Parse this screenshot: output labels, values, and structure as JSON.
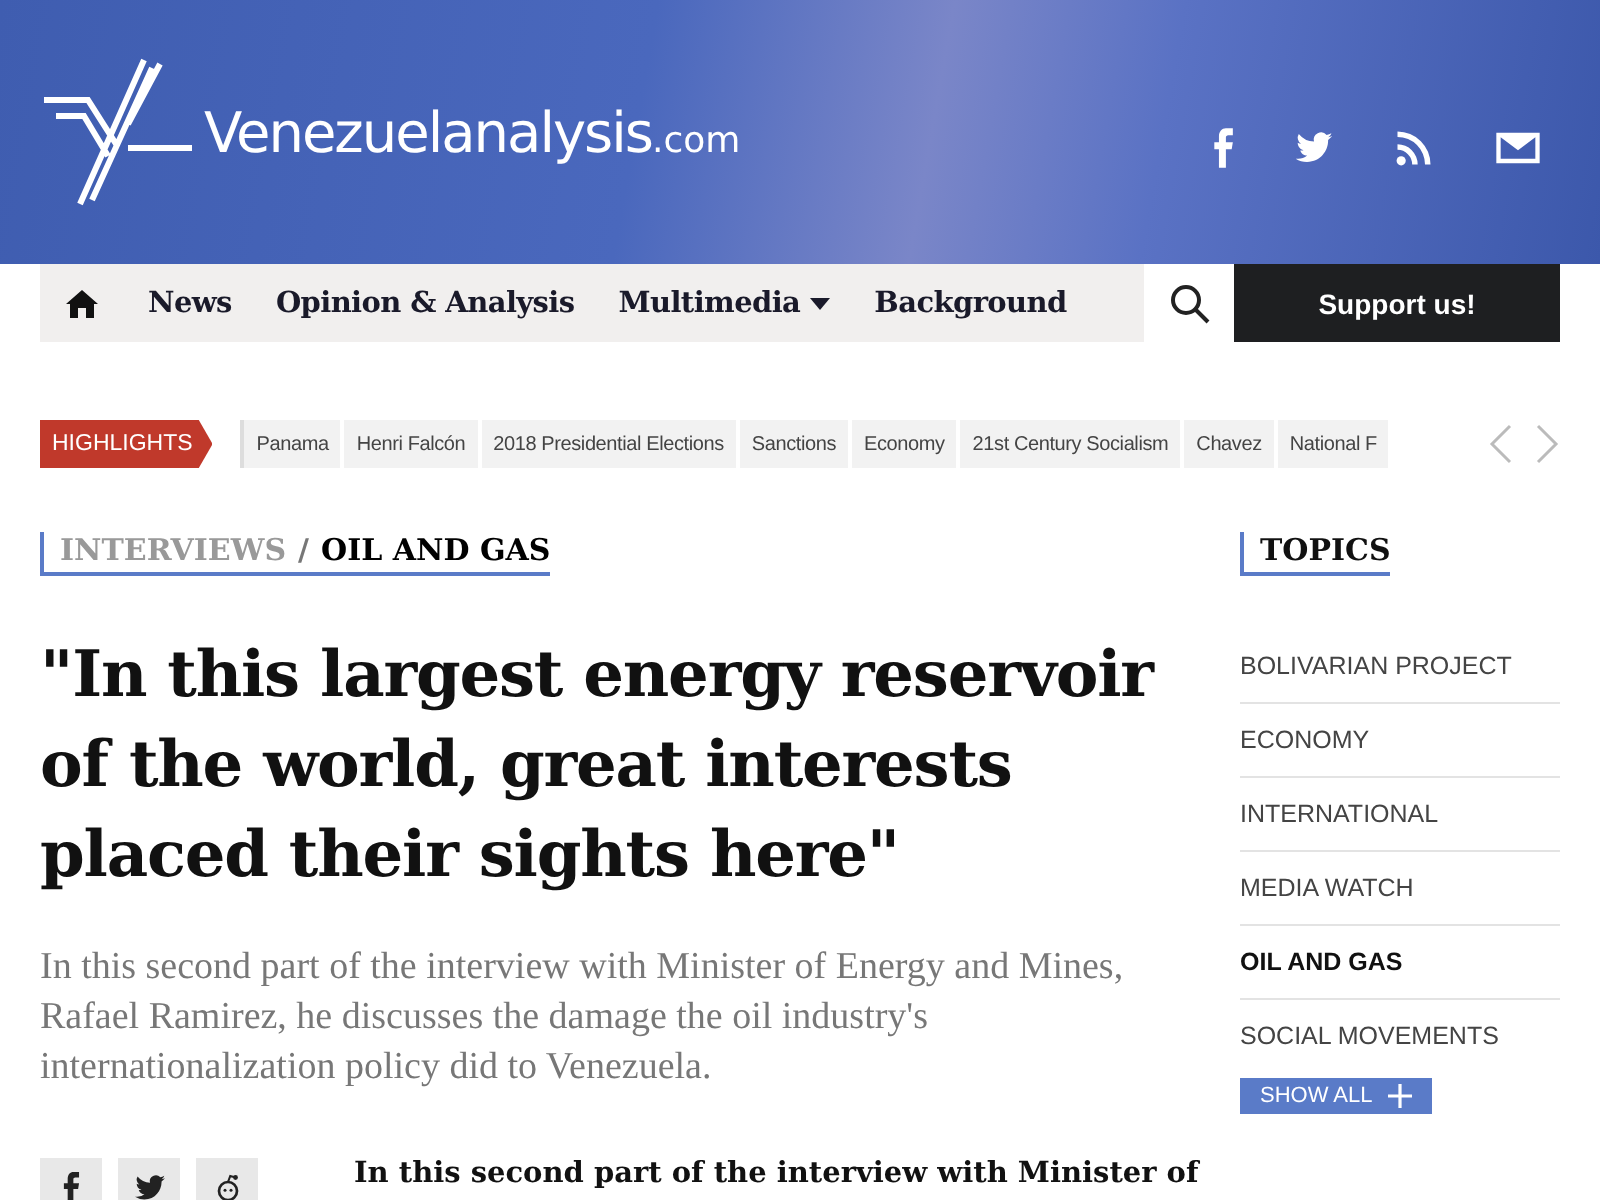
{
  "header": {
    "logo_text": "Venezuelanalysis",
    "logo_suffix": ".com",
    "social": [
      {
        "kind": "facebook"
      },
      {
        "kind": "twitter"
      },
      {
        "kind": "rss"
      },
      {
        "kind": "email"
      }
    ]
  },
  "nav": {
    "items": [
      {
        "label": "News",
        "dropdown": false
      },
      {
        "label": "Opinion & Analysis",
        "dropdown": false
      },
      {
        "label": "Multimedia",
        "dropdown": true
      },
      {
        "label": "Background",
        "dropdown": false
      }
    ],
    "support_button": "Support us!"
  },
  "highlights": {
    "label": "HIGHLIGHTS",
    "tags": [
      "Panama",
      "Henri Falcón",
      "2018 Presidential Elections",
      "Sanctions",
      "Economy",
      "21st Century Socialism",
      "Chavez",
      "National F"
    ]
  },
  "article": {
    "section": "INTERVIEWS",
    "separator": "/",
    "subsection": "OIL AND GAS",
    "headline": "\"In this largest energy reservoir of the world, great interests placed their sights here\"",
    "standfirst": "In this second part of the interview with Minister of Energy and Mines, Rafael Ramirez, he discusses the damage the oil industry's internationalization policy did to Venezuela.",
    "share": [
      {
        "kind": "facebook"
      },
      {
        "kind": "twitter"
      },
      {
        "kind": "reddit"
      }
    ],
    "body_start": "In this second part of the interview with Minister of"
  },
  "topics": {
    "title": "TOPICS",
    "items": [
      {
        "label": "BOLIVARIAN PROJECT",
        "selected": false
      },
      {
        "label": "ECONOMY",
        "selected": false
      },
      {
        "label": "INTERNATIONAL",
        "selected": false
      },
      {
        "label": "MEDIA WATCH",
        "selected": false
      },
      {
        "label": "OIL AND GAS",
        "selected": true
      },
      {
        "label": "SOCIAL MOVEMENTS",
        "selected": false
      }
    ],
    "show_all": "SHOW ALL"
  }
}
